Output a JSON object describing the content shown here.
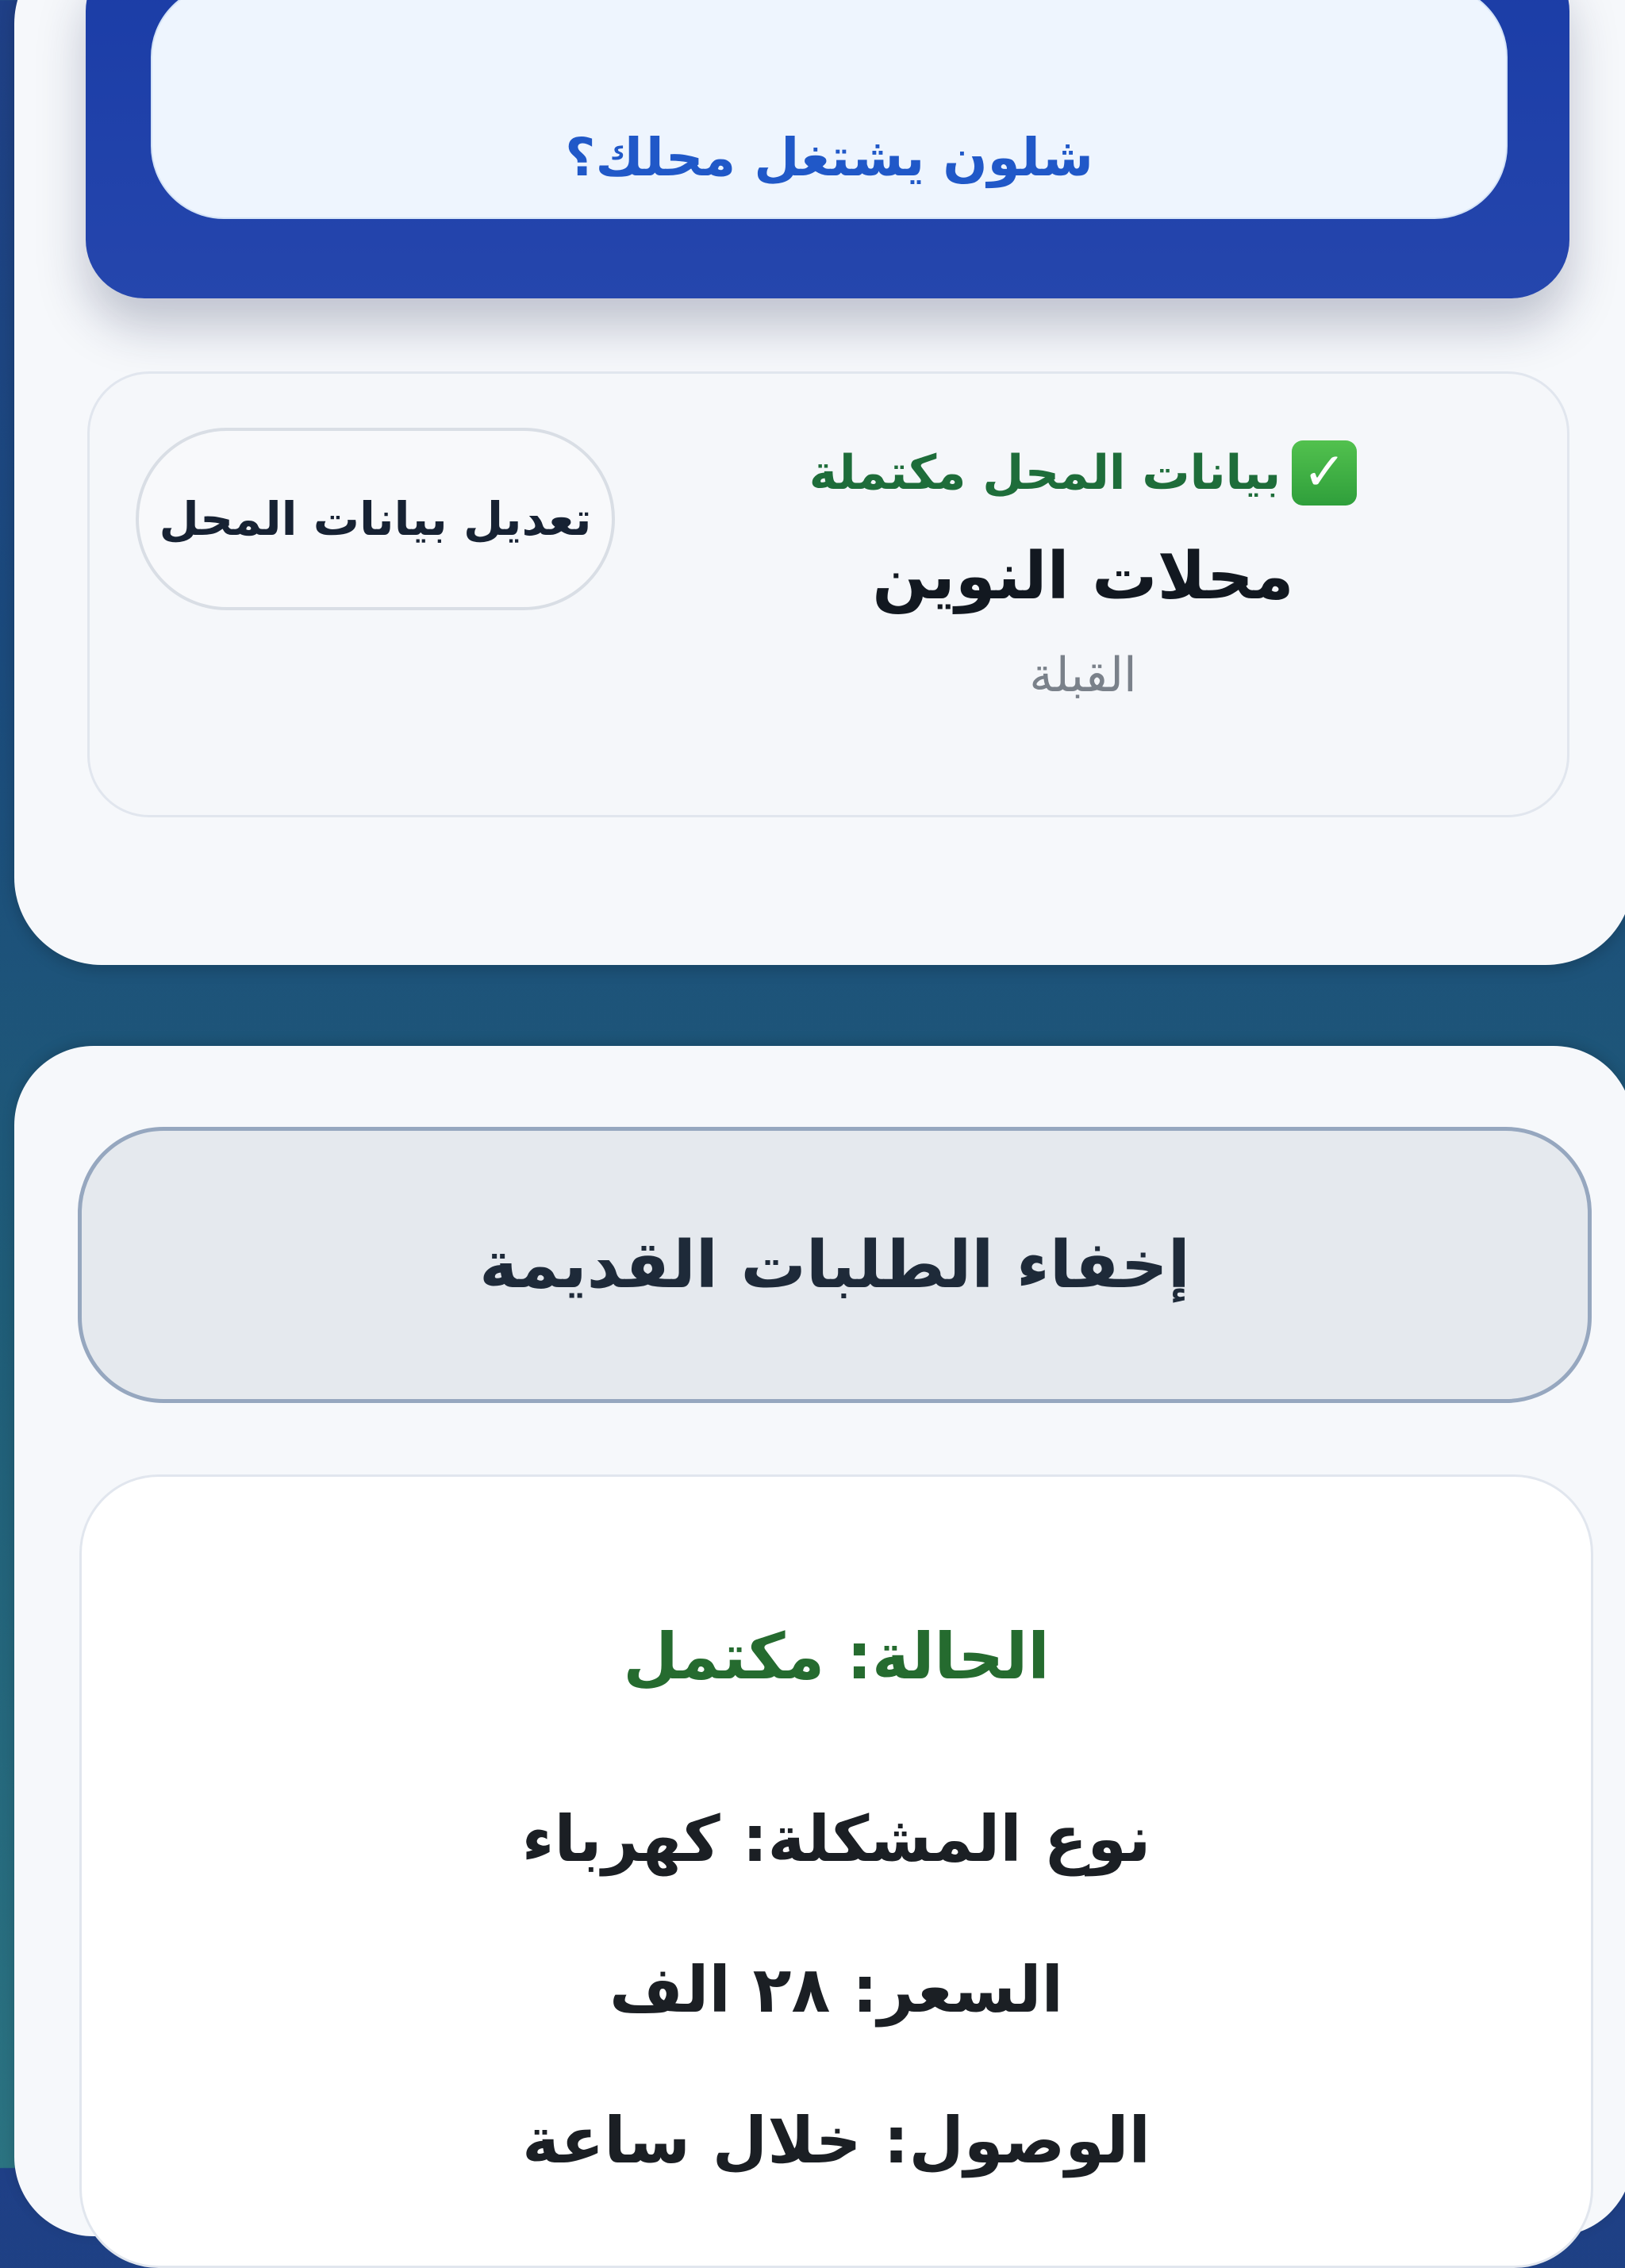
{
  "header": {
    "how_it_works_label": "شلون يشتغل محلك؟"
  },
  "shop_card": {
    "status_text": "بيانات المحل مكتملة",
    "status_icon": "check-icon",
    "shop_name": "محلات النوين",
    "shop_area": "القبلة",
    "edit_button_label": "تعديل بيانات المحل"
  },
  "orders": {
    "hide_old_label": "إخفاء الطلبات القديمة",
    "items": [
      {
        "status": "الحالة: مكتمل",
        "problem_type": "نوع المشكلة: كهرباء",
        "price": "السعر: ٢٨ الف",
        "arrival": "الوصول: خلال ساعة"
      }
    ]
  },
  "colors": {
    "accent_blue": "#2546ad",
    "link_blue": "#2058c8",
    "success_green": "#256b2f"
  }
}
